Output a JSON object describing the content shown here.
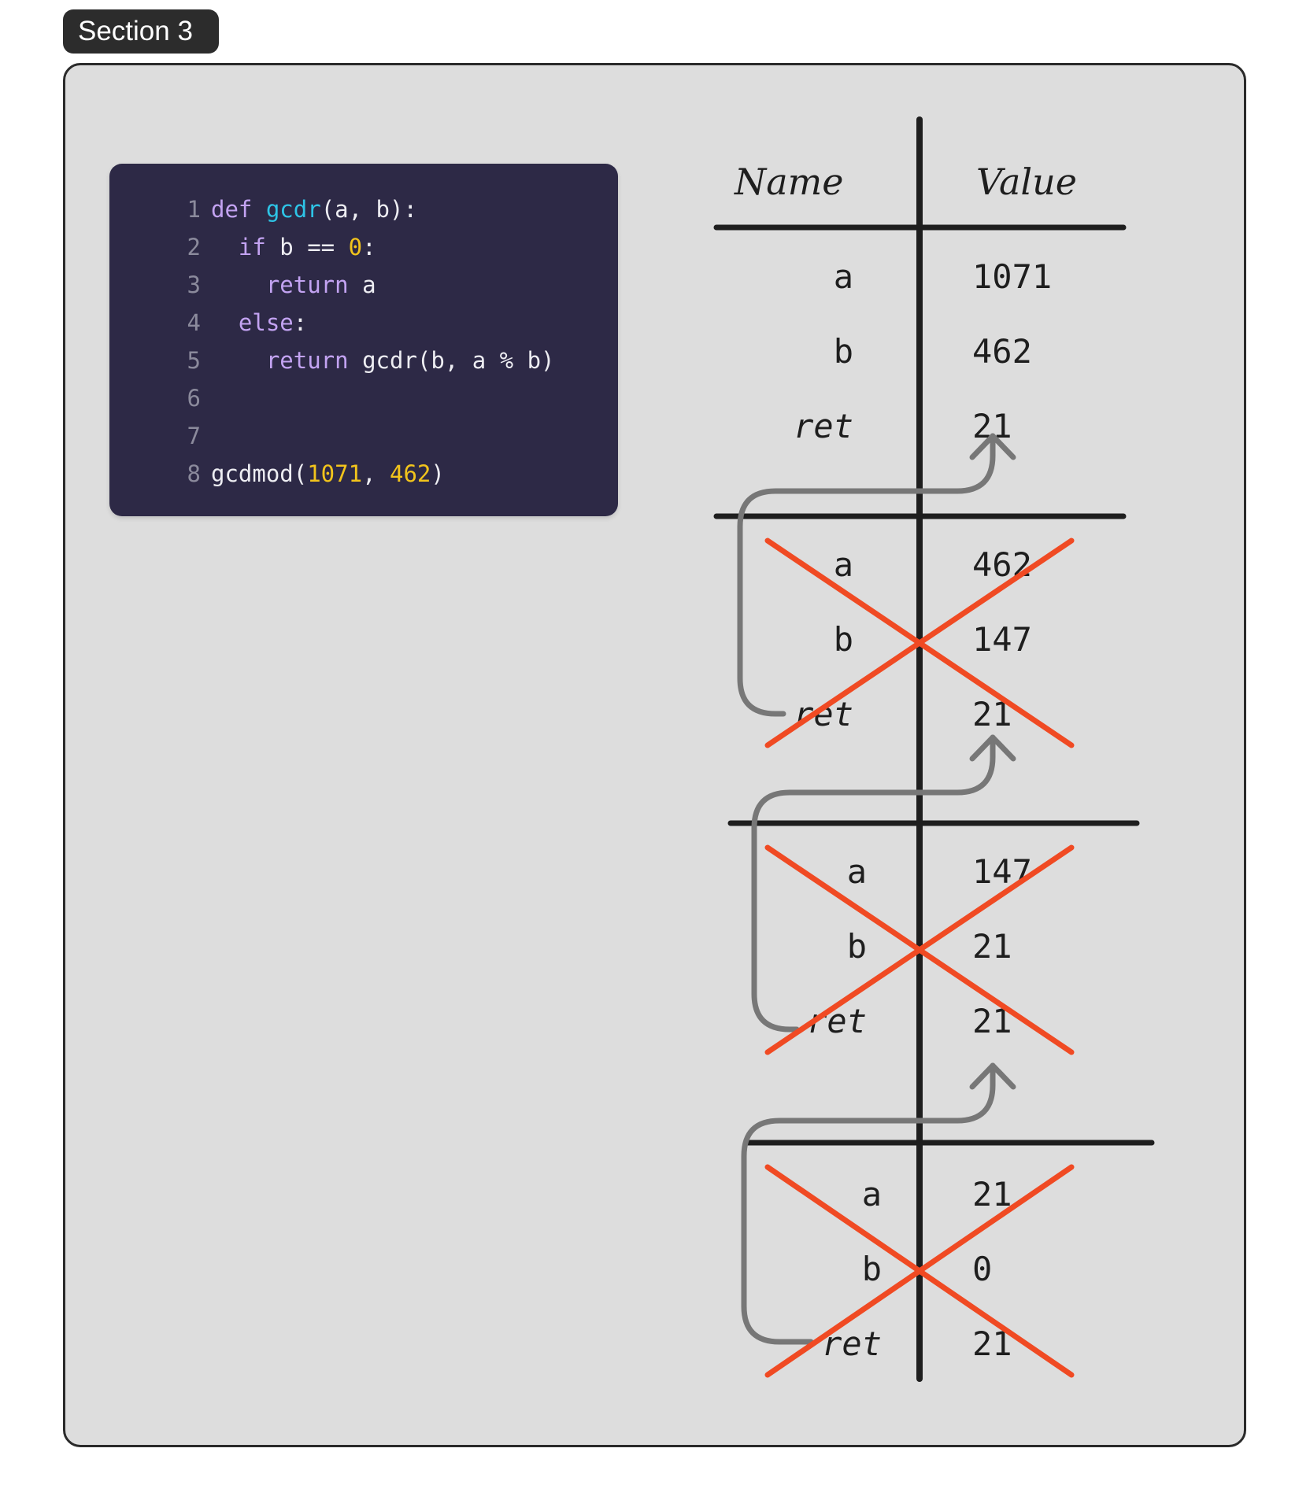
{
  "section_badge": "Section 3",
  "code": {
    "lines": [
      {
        "num": "1",
        "tokens": [
          {
            "t": "def ",
            "k": "kw"
          },
          {
            "t": "gcdr",
            "k": "fn"
          },
          {
            "t": "(a, b):",
            "k": "plain"
          }
        ]
      },
      {
        "num": "2",
        "tokens": [
          {
            "t": "  ",
            "k": "plain"
          },
          {
            "t": "if",
            "k": "kw"
          },
          {
            "t": " b == ",
            "k": "plain"
          },
          {
            "t": "0",
            "k": "num"
          },
          {
            "t": ":",
            "k": "plain"
          }
        ]
      },
      {
        "num": "3",
        "tokens": [
          {
            "t": "    ",
            "k": "plain"
          },
          {
            "t": "return",
            "k": "kw"
          },
          {
            "t": " a",
            "k": "plain"
          }
        ]
      },
      {
        "num": "4",
        "tokens": [
          {
            "t": "  ",
            "k": "plain"
          },
          {
            "t": "else",
            "k": "kw"
          },
          {
            "t": ":",
            "k": "plain"
          }
        ]
      },
      {
        "num": "5",
        "tokens": [
          {
            "t": "    ",
            "k": "plain"
          },
          {
            "t": "return",
            "k": "kw"
          },
          {
            "t": " gcdr(b, a % b)",
            "k": "plain"
          }
        ]
      },
      {
        "num": "6",
        "tokens": []
      },
      {
        "num": "7",
        "tokens": []
      },
      {
        "num": "8",
        "tokens": [
          {
            "t": "gcdmod(",
            "k": "plain"
          },
          {
            "t": "1071",
            "k": "num"
          },
          {
            "t": ", ",
            "k": "plain"
          },
          {
            "t": "462",
            "k": "num"
          },
          {
            "t": ")",
            "k": "plain"
          }
        ]
      }
    ]
  },
  "table": {
    "headers": {
      "name": "Name",
      "value": "Value"
    },
    "frames": [
      {
        "crossed_out": false,
        "rows": [
          {
            "name": "a",
            "value": "1071"
          },
          {
            "name": "b",
            "value": "462"
          },
          {
            "name": "ret",
            "value": "21"
          }
        ]
      },
      {
        "crossed_out": true,
        "rows": [
          {
            "name": "a",
            "value": "462"
          },
          {
            "name": "b",
            "value": "147"
          },
          {
            "name": "ret",
            "value": "21"
          }
        ]
      },
      {
        "crossed_out": true,
        "rows": [
          {
            "name": "a",
            "value": "147"
          },
          {
            "name": "b",
            "value": "21"
          },
          {
            "name": "ret",
            "value": "21"
          }
        ]
      },
      {
        "crossed_out": true,
        "rows": [
          {
            "name": "a",
            "value": "21"
          },
          {
            "name": "b",
            "value": "0"
          },
          {
            "name": "ret",
            "value": "21"
          }
        ]
      }
    ],
    "return_arrows": [
      {
        "from_frame": 1,
        "to_frame": 0
      },
      {
        "from_frame": 2,
        "to_frame": 1
      },
      {
        "from_frame": 3,
        "to_frame": 2
      }
    ]
  },
  "colors": {
    "ink": "#1e1e1e",
    "cross": "#f04a23",
    "arrow": "#777777",
    "panel_bg": "#dddddd",
    "code_bg": "#2d2946"
  }
}
